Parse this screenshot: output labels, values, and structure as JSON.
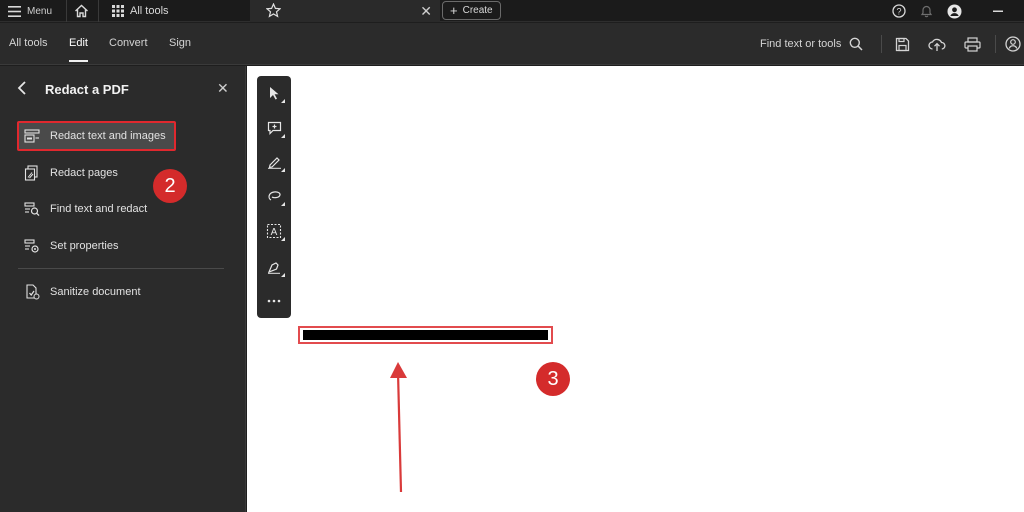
{
  "topbar": {
    "menu_label": "Menu",
    "alltools_tab_label": "All tools",
    "create_label": "Create"
  },
  "toolbar": {
    "tabs": [
      "All tools",
      "Edit",
      "Convert",
      "Sign"
    ],
    "active_tab": "Edit",
    "find_label": "Find text or tools"
  },
  "panel": {
    "title": "Redact a PDF",
    "items": [
      {
        "label": "Redact text and images",
        "icon": "redact-text-icon",
        "selected": true
      },
      {
        "label": "Redact pages",
        "icon": "redact-pages-icon"
      },
      {
        "label": "Find text and redact",
        "icon": "find-redact-icon"
      },
      {
        "label": "Set properties",
        "icon": "set-properties-icon"
      },
      {
        "label": "Sanitize document",
        "icon": "sanitize-icon"
      }
    ]
  },
  "quick_tools": [
    "select-icon",
    "add-comment-icon",
    "highlight-icon",
    "draw-icon",
    "text-box-icon",
    "fill-sign-icon",
    "more-icon"
  ],
  "annotations": {
    "badge_2": "2",
    "badge_3": "3"
  },
  "colors": {
    "accent_red": "#d42b2b",
    "highlight_border": "#e0282e",
    "arrow_red": "#d93a3a",
    "panel_bg": "#2b2b2b"
  }
}
